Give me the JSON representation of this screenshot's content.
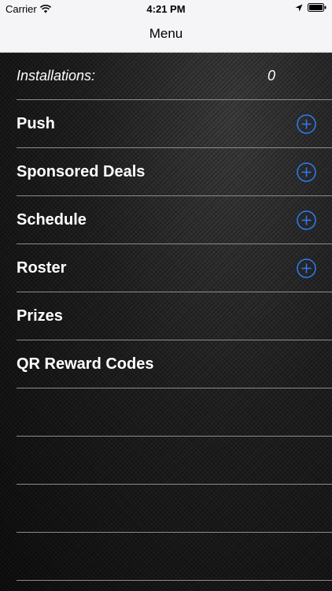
{
  "status_bar": {
    "carrier": "Carrier",
    "time": "4:21 PM",
    "icons": [
      "wifi-icon",
      "location-arrow-icon",
      "battery-icon"
    ]
  },
  "nav": {
    "title": "Menu"
  },
  "installations": {
    "label": "Installations:",
    "value": "0"
  },
  "menu_items": [
    {
      "label": "Push",
      "has_add": true
    },
    {
      "label": "Sponsored Deals",
      "has_add": true
    },
    {
      "label": "Schedule",
      "has_add": true
    },
    {
      "label": "Roster",
      "has_add": true
    },
    {
      "label": "Prizes",
      "has_add": false
    },
    {
      "label": "QR Reward Codes",
      "has_add": false
    }
  ],
  "empty_rows": 4,
  "colors": {
    "accent": "#2f7cf6",
    "background": "#121212",
    "navbar": "#f5f5f7",
    "separator": "#8c8c8c",
    "text": "#ffffff"
  }
}
